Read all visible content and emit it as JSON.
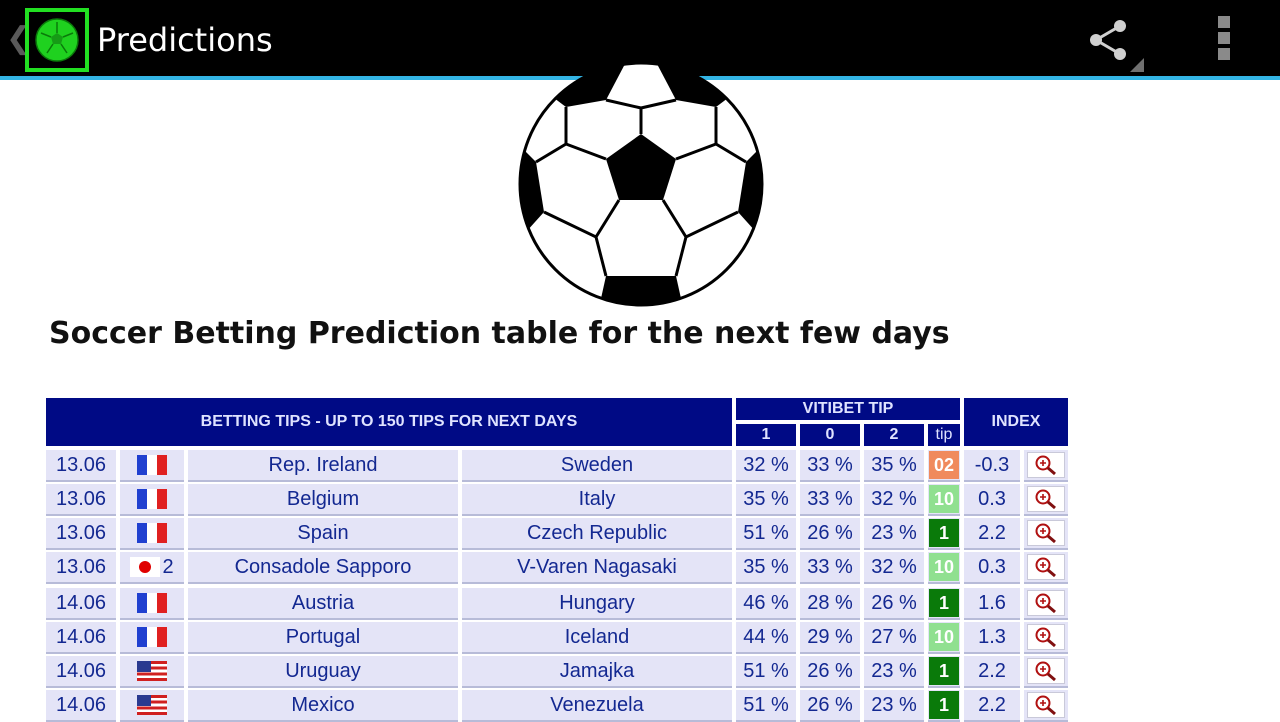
{
  "app": {
    "title": "Predictions",
    "icon": "soccer-ball-icon",
    "actions": [
      "share-icon",
      "overflow-menu-icon"
    ]
  },
  "page": {
    "heading": "Soccer Betting Prediction table for the next few days"
  },
  "table": {
    "header_tips": "BETTING TIPS - UP TO 150 TIPS FOR NEXT DAYS",
    "header_vitibet": "VITIBET TIP",
    "header_index": "INDEX",
    "sub_1": "1",
    "sub_0": "0",
    "sub_2": "2",
    "sub_tip": "tip",
    "rows": [
      {
        "date": "13.06",
        "flag": "fr",
        "flag_num": "",
        "home": "Rep. Ireland",
        "away": "Sweden",
        "p1": "32 %",
        "p0": "33 %",
        "p2": "35 %",
        "tip": "02",
        "tip_color": "#f08a5d",
        "index": "-0.3"
      },
      {
        "date": "13.06",
        "flag": "fr",
        "flag_num": "",
        "home": "Belgium",
        "away": "Italy",
        "p1": "35 %",
        "p0": "33 %",
        "p2": "32 %",
        "tip": "10",
        "tip_color": "#90e090",
        "index": "0.3"
      },
      {
        "date": "13.06",
        "flag": "fr",
        "flag_num": "",
        "home": "Spain",
        "away": "Czech Republic",
        "p1": "51 %",
        "p0": "26 %",
        "p2": "23 %",
        "tip": "1",
        "tip_color": "#0a7a0a",
        "index": "2.2"
      },
      {
        "date": "13.06",
        "flag": "jp",
        "flag_num": "2",
        "home": "Consadole Sapporo",
        "away": "V-Varen Nagasaki",
        "p1": "35 %",
        "p0": "33 %",
        "p2": "32 %",
        "tip": "10",
        "tip_color": "#90e090",
        "index": "0.3"
      },
      {
        "date": "14.06",
        "flag": "fr",
        "flag_num": "",
        "home": "Austria",
        "away": "Hungary",
        "p1": "46 %",
        "p0": "28 %",
        "p2": "26 %",
        "tip": "1",
        "tip_color": "#0a7a0a",
        "index": "1.6"
      },
      {
        "date": "14.06",
        "flag": "fr",
        "flag_num": "",
        "home": "Portugal",
        "away": "Iceland",
        "p1": "44 %",
        "p0": "29 %",
        "p2": "27 %",
        "tip": "10",
        "tip_color": "#90e090",
        "index": "1.3"
      },
      {
        "date": "14.06",
        "flag": "us",
        "flag_num": "",
        "home": "Uruguay",
        "away": "Jamajka",
        "p1": "51 %",
        "p0": "26 %",
        "p2": "23 %",
        "tip": "1",
        "tip_color": "#0a7a0a",
        "index": "2.2"
      },
      {
        "date": "14.06",
        "flag": "us",
        "flag_num": "",
        "home": "Mexico",
        "away": "Venezuela",
        "p1": "51 %",
        "p0": "26 %",
        "p2": "23 %",
        "tip": "1",
        "tip_color": "#0a7a0a",
        "index": "2.2"
      }
    ]
  },
  "colors": {
    "actionbar": "#000000",
    "accent_line": "#33b5e5",
    "table_header": "#000a85",
    "row_bg": "#e4e4f7",
    "row_text": "#132891"
  }
}
